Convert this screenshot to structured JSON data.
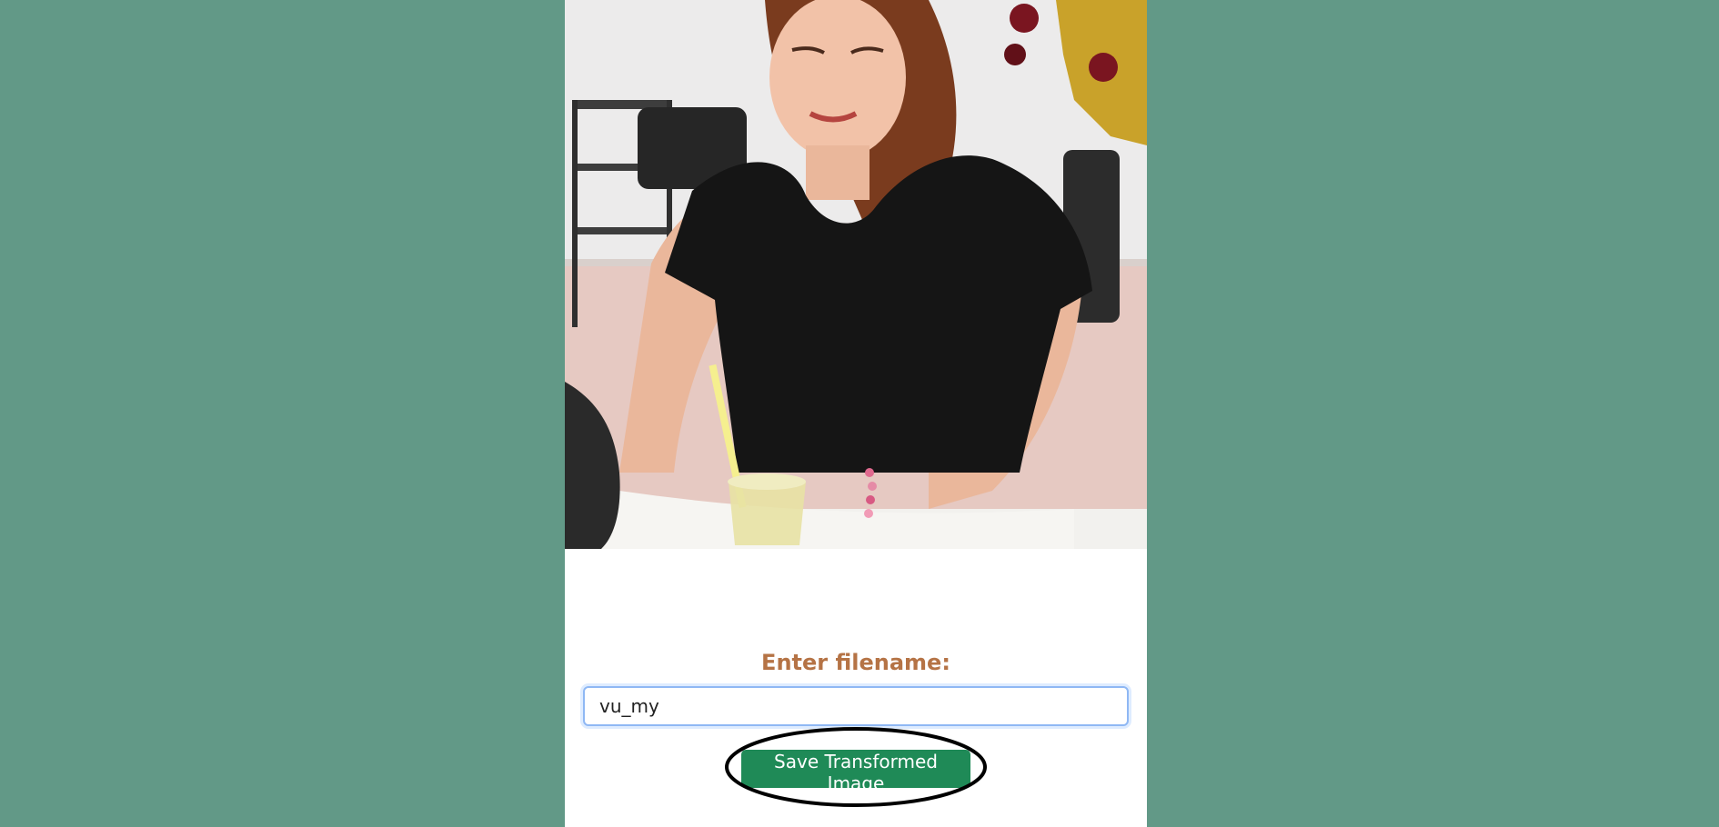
{
  "page": {
    "background_color": "#629987",
    "panel_color": "#ffffff"
  },
  "image": {
    "icon": "photo-of-person-at-table"
  },
  "form": {
    "label": "Enter filename:",
    "label_color": "#b57345",
    "input_value": "vu_my"
  },
  "actions": {
    "save_label": "Save Transformed Image",
    "save_color": "#1f8a57"
  }
}
